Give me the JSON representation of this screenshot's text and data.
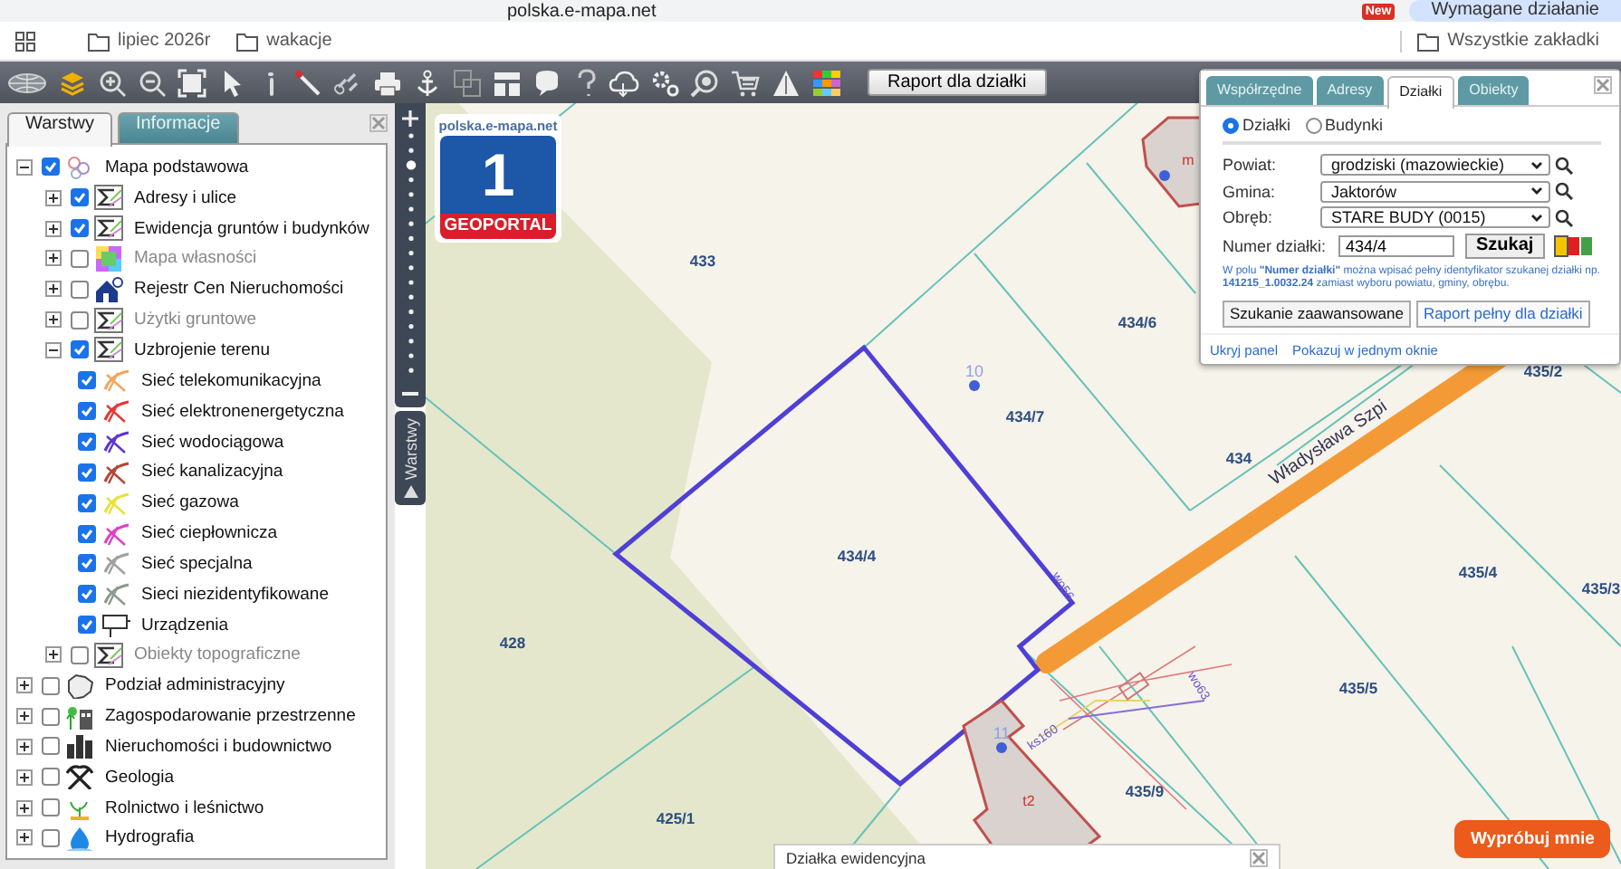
{
  "browser": {
    "address": "polska.e-mapa.net",
    "new_badge": "New",
    "action_chip": "Wymagane działanie",
    "bookmarks": [
      "lipiec 2026r",
      "wakacje"
    ],
    "all_bookmarks": "Wszystkie zakładki"
  },
  "toolbar": {
    "report_button": "Raport dla działki"
  },
  "layer_panel": {
    "tabs": [
      {
        "label": "Warstwy",
        "selected": true
      },
      {
        "label": "Informacje",
        "selected": false
      }
    ],
    "layers": [
      {
        "label": "Mapa podstawowa",
        "kind": "layers",
        "checked": true,
        "expanded": true,
        "disabled": false,
        "children": [
          {
            "label": "Adresy i ulice",
            "kind": "sigma",
            "checked": true,
            "expanded": false,
            "disabled": false
          },
          {
            "label": "Ewidencja gruntów i budynków",
            "kind": "sigma",
            "checked": true,
            "expanded": false,
            "disabled": false
          },
          {
            "label": "Mapa własności",
            "kind": "colormap",
            "checked": false,
            "expanded": false,
            "disabled": true
          },
          {
            "label": "Rejestr Cen Nieruchomości",
            "kind": "house",
            "checked": false,
            "expanded": false,
            "disabled": false
          },
          {
            "label": "Użytki gruntowe",
            "kind": "sigma",
            "checked": false,
            "expanded": false,
            "disabled": true
          },
          {
            "label": "Uzbrojenie terenu",
            "kind": "sigma",
            "checked": true,
            "expanded": true,
            "disabled": false,
            "children": [
              {
                "label": "Sieć telekomunikacyjna",
                "kind": "network",
                "color": "#f4a460",
                "checked": true,
                "disabled": false
              },
              {
                "label": "Sieć elektronenergetyczna",
                "kind": "network",
                "color": "#e53935",
                "checked": true,
                "disabled": false
              },
              {
                "label": "Sieć wodociągowa",
                "kind": "network",
                "color": "#5e35d1",
                "checked": true,
                "disabled": false
              },
              {
                "label": "Sieć kanalizacyjna",
                "kind": "network",
                "color": "#b5473a",
                "checked": true,
                "disabled": false
              },
              {
                "label": "Sieć gazowa",
                "kind": "network",
                "color": "#e6e23a",
                "checked": true,
                "disabled": false
              },
              {
                "label": "Sieć ciepłownicza",
                "kind": "network",
                "color": "#e040c8",
                "checked": true,
                "disabled": false
              },
              {
                "label": "Sieć specjalna",
                "kind": "network",
                "color": "#a0a0a0",
                "checked": true,
                "disabled": false
              },
              {
                "label": "Sieci niezidentyfikowane",
                "kind": "network",
                "color": "#8c9a8c",
                "checked": true,
                "disabled": false
              },
              {
                "label": "Urządzenia",
                "kind": "device",
                "checked": true,
                "disabled": false
              }
            ]
          },
          {
            "label": "Obiekty topograficzne",
            "kind": "sigma",
            "checked": false,
            "expanded": false,
            "disabled": true
          }
        ]
      },
      {
        "label": "Podział administracyjny",
        "kind": "outline",
        "checked": false,
        "expanded": false,
        "disabled": false
      },
      {
        "label": "Zagospodarowanie przestrzenne",
        "kind": "plan",
        "checked": false,
        "expanded": false,
        "disabled": false
      },
      {
        "label": "Nieruchomości i budownictwo",
        "kind": "buildings",
        "checked": false,
        "expanded": false,
        "disabled": false
      },
      {
        "label": "Geologia",
        "kind": "tools",
        "checked": false,
        "expanded": false,
        "disabled": false
      },
      {
        "label": "Rolnictwo i leśnictwo",
        "kind": "sprout",
        "checked": false,
        "expanded": false,
        "disabled": false
      },
      {
        "label": "Hydrografia",
        "kind": "drop",
        "checked": false,
        "expanded": false,
        "disabled": false
      }
    ]
  },
  "zoom_slider": {
    "level": 0.875
  },
  "side_tab": {
    "label": "Warstwy"
  },
  "map": {
    "logo": {
      "site": "polska.e-mapa.net",
      "number": "1",
      "name": "GEOPORTAL"
    },
    "parcels": [
      "433",
      "434/6",
      "434/7",
      "434/4",
      "428",
      "425/1",
      "435/9",
      "435/5",
      "435/4",
      "435/2",
      "435/3",
      "434"
    ],
    "address_points": [
      "10",
      "11"
    ],
    "street": "Władysława Szpi",
    "utility_labels": [
      "wo56",
      "ks160",
      "wo63"
    ],
    "building_labels": [
      "t2",
      "m"
    ]
  },
  "search_panel": {
    "tabs": [
      {
        "label": "Współrzędne",
        "selected": false
      },
      {
        "label": "Adresy",
        "selected": false
      },
      {
        "label": "Działki",
        "selected": true
      },
      {
        "label": "Obiekty",
        "selected": false
      }
    ],
    "modes": [
      {
        "label": "Działki",
        "selected": true
      },
      {
        "label": "Budynki",
        "selected": false
      }
    ],
    "fields": [
      {
        "label": "Powiat:",
        "value": "grodziski (mazowieckie)"
      },
      {
        "label": "Gmina:",
        "value": "Jaktorów"
      },
      {
        "label": "Obręb:",
        "value": "STARE BUDY (0015)"
      }
    ],
    "parcel_number": {
      "label": "Numer działki:",
      "value": "434/4"
    },
    "search_button": "Szukaj",
    "status_colors": [
      {
        "color": "#f5c400",
        "selected": true
      },
      {
        "color": "#e02020",
        "selected": false
      },
      {
        "color": "#43a047",
        "selected": false
      }
    ],
    "hint": "W polu **\"Numer działki\"** można wpisać pełny identyfikator szukanej działki np. **141215_1.0032.24** zamiast wyboru powiatu, gminy, obrębu.",
    "buttons": [
      {
        "label": "Szukanie zaawansowane",
        "kind": "default"
      },
      {
        "label": "Raport pełny dla działki",
        "kind": "link"
      }
    ],
    "links": [
      "Ukryj panel",
      "Pokazuj w jednym oknie"
    ]
  },
  "info_panel": {
    "title": "Działka ewidencyjna"
  },
  "try_button": "Wypróbuj mnie"
}
